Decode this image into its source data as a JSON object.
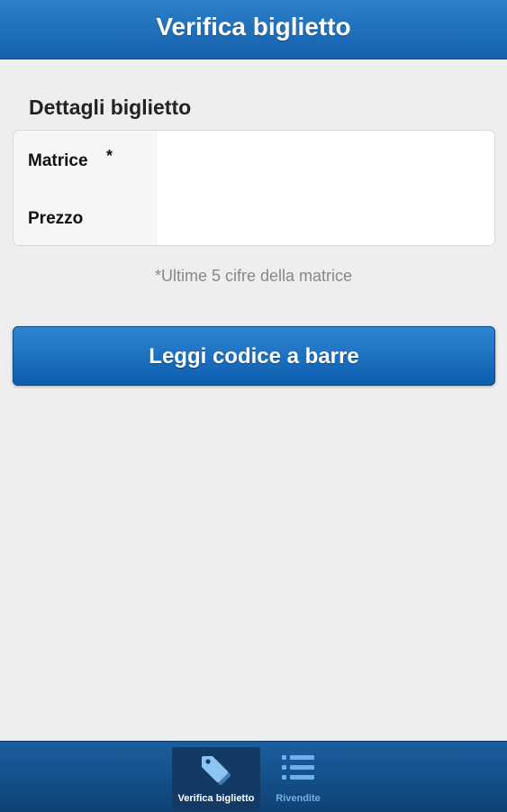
{
  "header": {
    "title": "Verifica biglietto"
  },
  "details": {
    "section_title": "Dettagli biglietto",
    "fields": [
      {
        "label": "Matrice",
        "required_mark": "*",
        "value": ""
      },
      {
        "label": "Prezzo",
        "value": ""
      }
    ],
    "hint": "*Ultime 5 cifre della matrice"
  },
  "actions": {
    "scan_barcode_label": "Leggi codice a barre"
  },
  "navbar": {
    "items": [
      {
        "label": "Verifica biglietto",
        "icon": "tag-icon",
        "active": true
      },
      {
        "label": "Rivendite",
        "icon": "list-icon",
        "active": false
      }
    ]
  },
  "colors": {
    "primary": "#1461ad",
    "background": "#eeeeee",
    "nav_active_label": "#ffffff",
    "nav_inactive_label": "#6fb0ec"
  }
}
